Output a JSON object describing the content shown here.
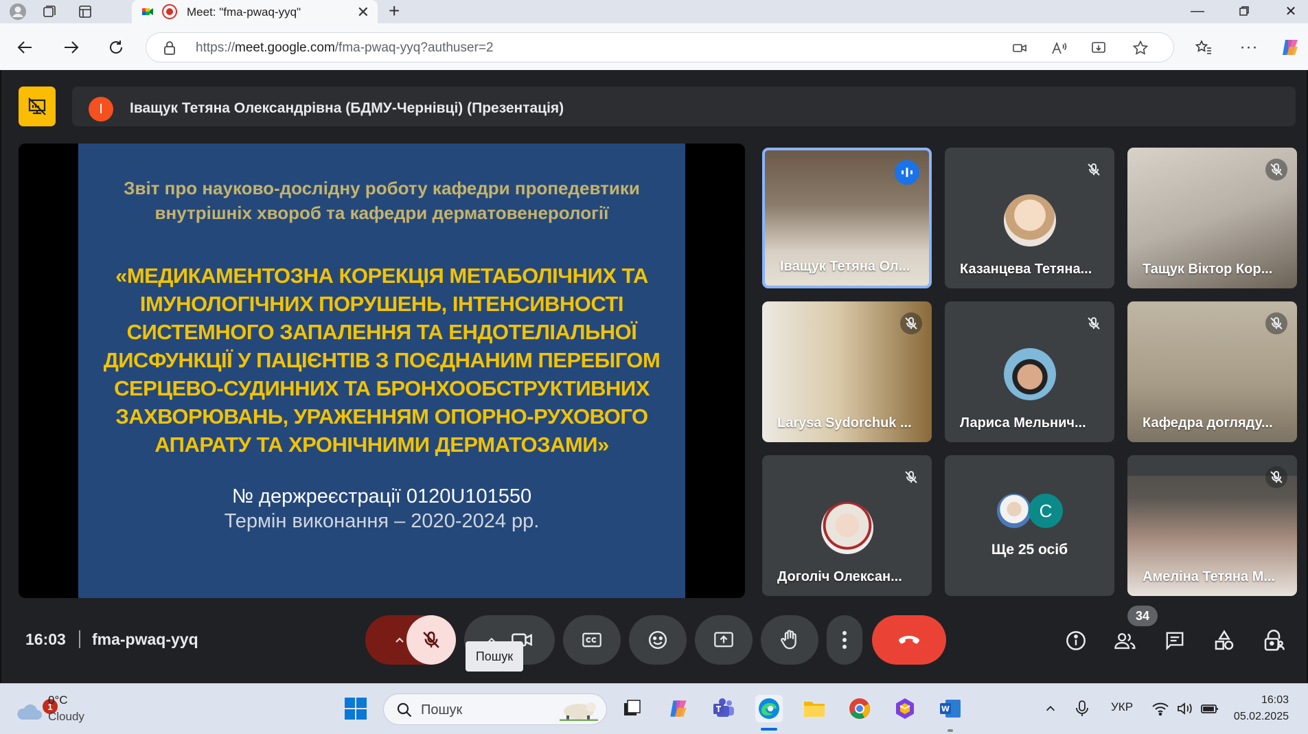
{
  "browser": {
    "tab_title": "Meet: \"fma-pwaq-yyq\"",
    "url_prefix": "https://",
    "url_host": "meet.google.com",
    "url_path": "/fma-pwaq-yyq?authuser=2"
  },
  "meet": {
    "presenter_initial": "І",
    "presenter_label": "Іващук Тетяна Олександрівна (БДМУ-Чернівці) (Презентація)",
    "slide": {
      "heading": "Звіт про науково-дослідну роботу кафедри пропедевтики внутрішніх хвороб та кафедри дерматовенерології",
      "title": "«МЕДИКАМЕНТОЗНА КОРЕКЦІЯ МЕТАБОЛІЧНИХ ТА ІМУНОЛОГІЧНИХ ПОРУШЕНЬ, ІНТЕНСИВНОСТІ СИСТЕМНОГО ЗАПАЛЕННЯ ТА ЕНДОТЕЛІАЛЬНОЇ ДИСФУНКЦІЇ У ПАЦІЄНТІВ З ПОЄДНАНИМ ПЕРЕБІГОМ СЕРЦЕВО-СУДИННИХ ТА БРОНХООБСТРУКТИВНИХ ЗАХВОРЮВАНЬ, УРАЖЕННЯМ ОПОРНО-РУХОВОГО АПАРАТУ ТА ХРОНІЧНИМИ ДЕРМАТОЗАМИ»",
      "registration": "№ держреєстрації 0120U101550",
      "term": "Термін виконання – 2020-2024 рр."
    },
    "participants": [
      {
        "name": "Іващук Тетяна Ол...",
        "state": "speaking"
      },
      {
        "name": "Казанцева Тетяна...",
        "state": "muted"
      },
      {
        "name": "Тащук Віктор Кор...",
        "state": "muted"
      },
      {
        "name": "Larysa Sydorchuk ...",
        "state": "muted"
      },
      {
        "name": "Лариса Мельнич...",
        "state": "muted"
      },
      {
        "name": "Кафедра догляду...",
        "state": "muted"
      },
      {
        "name": "Доголіч Олексан...",
        "state": "muted"
      },
      {
        "name": "Ще 25 осіб",
        "more_initial": "C"
      },
      {
        "name": "Амеліна Тетяна М...",
        "state": "muted"
      }
    ],
    "time": "16:03",
    "meeting_code": "fma-pwaq-yyq",
    "tooltip": "Пошук",
    "people_count": "34"
  },
  "taskbar": {
    "weather_temp": "0°C",
    "weather_cond": "Cloudy",
    "notification_count": "1",
    "search_placeholder": "Пошук",
    "language": "УКР",
    "time": "16:03",
    "date": "05.02.2025"
  },
  "colors": {
    "meet_bg": "#202124",
    "tile_bg": "#3c4043",
    "leave_red": "#ea4335",
    "slide_blue": "#25487b",
    "slide_yellow": "#f2c300",
    "active_border": "#8ab4f8"
  }
}
